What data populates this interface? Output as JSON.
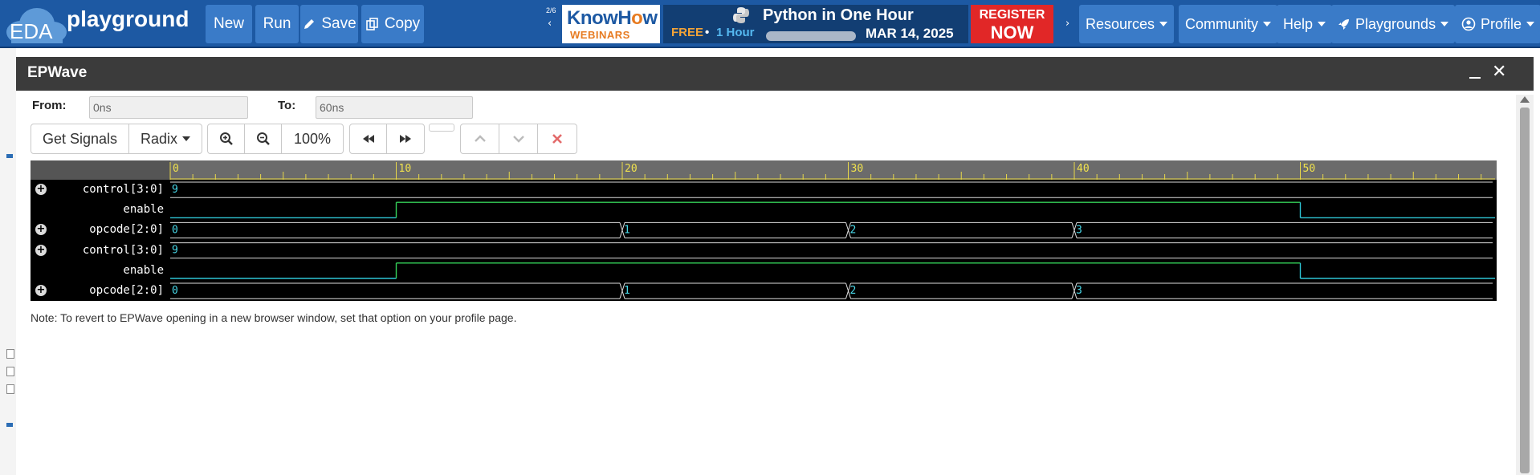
{
  "navbar": {
    "logo_eda": "EDA",
    "logo_playground": "playground",
    "buttons": {
      "new": "New",
      "run": "Run",
      "save": "Save",
      "copy": "Copy"
    },
    "carousel_counter": "2/6",
    "banner": {
      "brand_know": "KnowH",
      "brand_o": "o",
      "brand_w": "w",
      "brand_sub": "WEBINARS",
      "title": "Python in One Hour",
      "free": "FREE",
      "dot": "•",
      "hour": "1 Hour",
      "date": "MAR 14, 2025",
      "register_1": "REGISTER",
      "register_2": "NOW"
    },
    "menus": {
      "resources": "Resources",
      "community": "Community",
      "help": "Help",
      "playgrounds": "Playgrounds",
      "profile": "Profile"
    }
  },
  "epwave": {
    "title": "EPWave",
    "from_label": "From:",
    "from_value": "0ns",
    "to_label": "To:",
    "to_value": "60ns",
    "toolbar": {
      "get_signals": "Get Signals",
      "radix": "Radix",
      "zoom_level": "100%"
    },
    "note": "Note: To revert to EPWave opening in a new browser window, set that option on your profile page."
  },
  "waveform": {
    "time_start": 0,
    "time_end": 60,
    "major_ticks": [
      0,
      10,
      20,
      30,
      40,
      50
    ],
    "signals": [
      {
        "name": "control[3:0]",
        "bus": true,
        "segments": [
          {
            "t": 0,
            "value": "9"
          }
        ]
      },
      {
        "name": "enable",
        "bus": false,
        "transitions": [
          {
            "t": 0,
            "level": 0
          },
          {
            "t": 10,
            "level": 1
          },
          {
            "t": 50,
            "level": 0
          }
        ]
      },
      {
        "name": "opcode[2:0]",
        "bus": true,
        "segments": [
          {
            "t": 0,
            "value": "0"
          },
          {
            "t": 20,
            "value": "1"
          },
          {
            "t": 30,
            "value": "2"
          },
          {
            "t": 40,
            "value": "3"
          }
        ]
      },
      {
        "name": "control[3:0]",
        "bus": true,
        "segments": [
          {
            "t": 0,
            "value": "9"
          }
        ]
      },
      {
        "name": "enable",
        "bus": false,
        "transitions": [
          {
            "t": 0,
            "level": 0
          },
          {
            "t": 10,
            "level": 1
          },
          {
            "t": 50,
            "level": 0
          }
        ]
      },
      {
        "name": "opcode[2:0]",
        "bus": true,
        "segments": [
          {
            "t": 0,
            "value": "0"
          },
          {
            "t": 20,
            "value": "1"
          },
          {
            "t": 30,
            "value": "2"
          },
          {
            "t": 40,
            "value": "3"
          }
        ]
      }
    ]
  }
}
